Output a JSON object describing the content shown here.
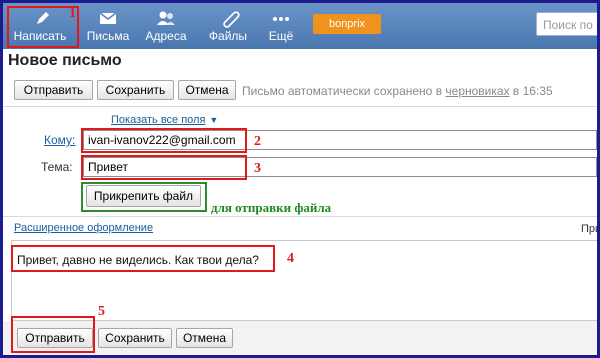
{
  "nav": {
    "compose": "Написать",
    "letters": "Письма",
    "contacts": "Адреса",
    "files": "Файлы",
    "more": "Ещё",
    "brand": "bonprix",
    "search_placeholder": "Поиск по почте"
  },
  "page_title": "Новое письмо",
  "toolbar": {
    "send": "Отправить",
    "save": "Сохранить",
    "cancel": "Отмена",
    "autosave_prefix": "Письмо автоматически сохранено в ",
    "autosave_link": "черновиках",
    "autosave_suffix": " в 16:35"
  },
  "fields": {
    "show_all": "Показать все поля",
    "to_label": "Кому:",
    "to_value": "ivan-ivanov222@gmail.com",
    "subject_label": "Тема:",
    "subject_value": "Привет",
    "attach": "Прикрепить файл"
  },
  "editor": {
    "rich_link": "Расширенное оформление",
    "right_stub": "При",
    "body": "Привет, давно не виделись. Как твои дела?"
  },
  "annotations": {
    "n1": "1",
    "n2": "2",
    "n3": "3",
    "n4": "4",
    "n5": "5",
    "attach_note": "для отправки файла"
  },
  "colors": {
    "nav": "#4a76b0",
    "highlight": "#e01a1a",
    "note": "#1f8a1f",
    "link": "#1a5ea0"
  }
}
